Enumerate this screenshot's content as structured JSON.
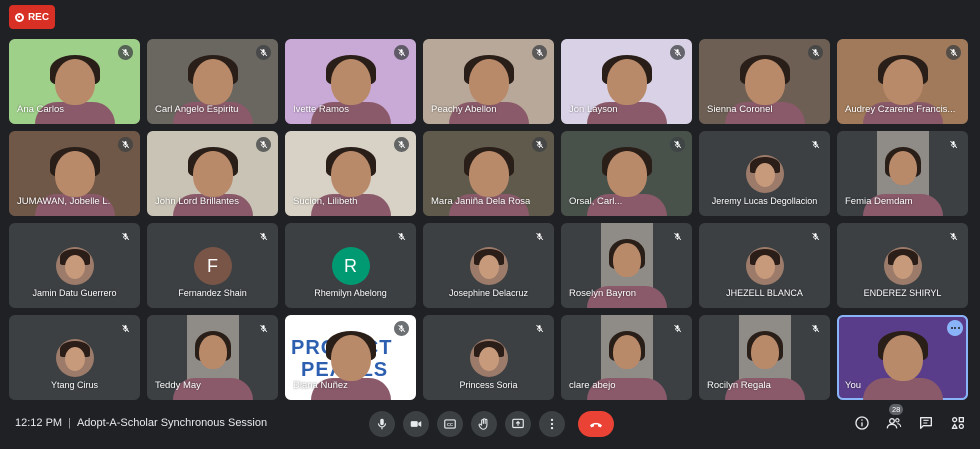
{
  "recording": {
    "label": "REC",
    "color": "#d93025"
  },
  "participants": [
    {
      "name": "Ana Carlos",
      "kind": "video",
      "bg": "#9fd08a"
    },
    {
      "name": "Carl Angelo Espiritu",
      "kind": "video",
      "bg": "#6a6660"
    },
    {
      "name": "Ivette Ramos",
      "kind": "video",
      "bg": "#c9a9d6"
    },
    {
      "name": "Peachy Abellon",
      "kind": "video",
      "bg": "#b8a89a"
    },
    {
      "name": "Jon Layson",
      "kind": "video",
      "bg": "#d9d2e6"
    },
    {
      "name": "Sienna Coronel",
      "kind": "video",
      "bg": "#6d5f54"
    },
    {
      "name": "Audrey Czarene Francis...",
      "kind": "video",
      "bg": "#a07a5a"
    },
    {
      "name": "JUMAWAN, Jobelle L.",
      "kind": "video",
      "bg": "#6f5848"
    },
    {
      "name": "John Lord Brillantes",
      "kind": "video",
      "bg": "#c9c3b5"
    },
    {
      "name": "Sucion, Lilibeth",
      "kind": "video",
      "bg": "#d8d2c6"
    },
    {
      "name": "Mara Janiña Dela Rosa",
      "kind": "video",
      "bg": "#5f5a4b"
    },
    {
      "name": "Orsal, Carl...",
      "kind": "video",
      "bg": "#48514a"
    },
    {
      "name": "Jeremy Lucas Degollacion",
      "kind": "avatar-photo",
      "bg": "#3c4043"
    },
    {
      "name": "Femia Demdam",
      "kind": "portrait",
      "bg": "#3c4043"
    },
    {
      "name": "Jamin Datu Guerrero",
      "kind": "avatar-photo",
      "bg": "#3c4043"
    },
    {
      "name": "Fernandez Shain",
      "kind": "avatar-letter",
      "letter": "F",
      "avatar_color": "#795548",
      "bg": "#3c4043"
    },
    {
      "name": "Rhemilyn Abelong",
      "kind": "avatar-letter",
      "letter": "R",
      "avatar_color": "#009a72",
      "bg": "#3c4043"
    },
    {
      "name": "Josephine Delacruz",
      "kind": "avatar-photo",
      "bg": "#3c4043"
    },
    {
      "name": "Roselyn Bayron",
      "kind": "portrait",
      "bg": "#3c4043"
    },
    {
      "name": "JHEZELL BLANCA",
      "kind": "avatar-photo",
      "bg": "#3c4043"
    },
    {
      "name": "ENDEREZ SHIRYL",
      "kind": "avatar-photo",
      "bg": "#3c4043"
    },
    {
      "name": "Ytang Cirus",
      "kind": "avatar-photo",
      "bg": "#3c4043"
    },
    {
      "name": "Teddy May",
      "kind": "portrait",
      "bg": "#3c4043"
    },
    {
      "name": "Diana Nuñez",
      "kind": "video-logo",
      "logo_top": "PROJECT",
      "logo_bottom": "PEARLS",
      "bg": "#ffffff"
    },
    {
      "name": "Princess Soria",
      "kind": "avatar-photo",
      "bg": "#3c4043"
    },
    {
      "name": "clare abejo",
      "kind": "portrait",
      "bg": "#3c4043"
    },
    {
      "name": "Rocilyn Regala",
      "kind": "portrait",
      "bg": "#3c4043"
    },
    {
      "name": "You",
      "kind": "self",
      "bg": "#5a3d8a"
    }
  ],
  "bottom_bar": {
    "time": "12:12 PM",
    "separator": "|",
    "meeting_title": "Adopt-A-Scholar Synchronous Session",
    "people_count": "28",
    "end_call_color": "#ea4335"
  }
}
